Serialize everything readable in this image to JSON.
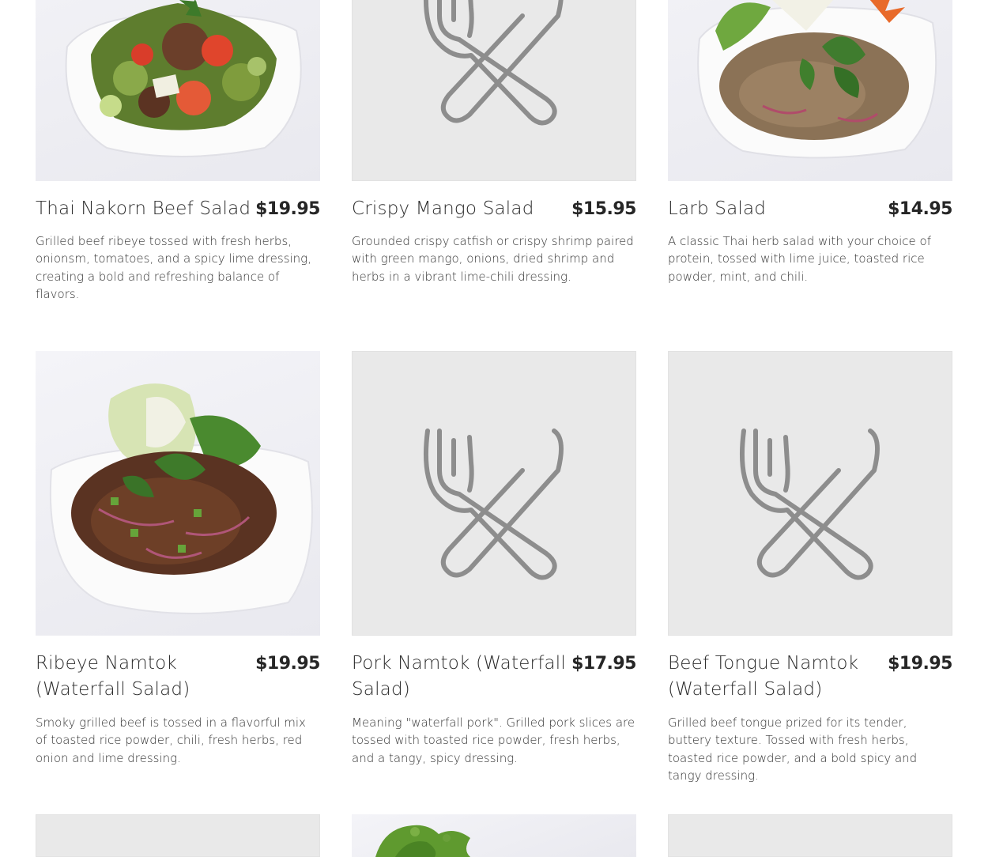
{
  "menu": {
    "items": [
      {
        "name": "Thai Nakorn Beef Salad",
        "price": "$19.95",
        "description": "Grilled beef ribeye tossed with fresh herbs, onionsm, tomatoes, and a spicy lime dressing, creating a bold and refreshing balance of flavors.",
        "image": "beef-salad-photo"
      },
      {
        "name": "Crispy Mango Salad",
        "price": "$15.95",
        "description": "Grounded crispy catfish or crispy shrimp paired with green mango, onions, dried shrimp and herbs in a vibrant lime-chili dressing.",
        "image": "fork-knife-placeholder-icon"
      },
      {
        "name": "Larb Salad",
        "price": "$14.95",
        "description": "A classic Thai herb salad with your choice of protein, tossed with lime juice, toasted rice powder, mint, and chili.",
        "image": "larb-salad-photo"
      },
      {
        "name": "Ribeye Namtok (Waterfall Salad)",
        "price": "$19.95",
        "description": "Smoky grilled beef is tossed in a flavorful mix of toasted rice powder, chili, fresh herbs, red onion and lime dressing.",
        "image": "namtok-salad-photo"
      },
      {
        "name": "Pork Namtok (Waterfall Salad)",
        "price": "$17.95",
        "description": "Meaning \"waterfall pork\". Grilled pork slices are tossed with toasted rice powder, fresh herbs, and a tangy, spicy dressing.",
        "image": "fork-knife-placeholder-icon"
      },
      {
        "name": "Beef Tongue Namtok (Waterfall Salad)",
        "price": "$19.95",
        "description": "Grilled beef tongue prized for its tender, buttery texture. Tossed with fresh herbs, toasted rice powder, and a bold spicy and tangy dressing.",
        "image": "fork-knife-placeholder-icon"
      }
    ],
    "next_row_images": [
      "placeholder-image",
      "herb-garnish-photo",
      "placeholder-image"
    ]
  },
  "colors": {
    "placeholder_bg": "#e9e9e9",
    "placeholder_icon": "#8d8d8d",
    "text": "#2b2b2b"
  }
}
